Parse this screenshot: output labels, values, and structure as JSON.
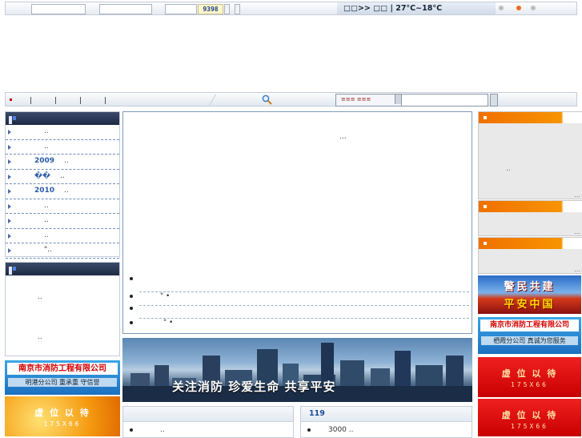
{
  "topbar": {
    "counter": "9398",
    "weather": "□□>> □□ | 27°C~18°C"
  },
  "colors": {
    "accent_orange": "#f07000",
    "accent_red": "#d40000",
    "accent_blue": "#1c4f9c",
    "nav_dark": "#1e2a44"
  },
  "nav": {
    "search_select": "≡≡≡ ≡≡≡",
    "icons": [
      "red-square-icon",
      "search-icon",
      "dropdown-arrow-icon"
    ]
  },
  "left": {
    "box1_rows": [
      {
        "year": "",
        "text": ".."
      },
      {
        "year": "",
        "text": ".."
      },
      {
        "year": "2009",
        "text": ".."
      },
      {
        "year": "��",
        "text": ".."
      },
      {
        "year": "2010",
        "text": ".."
      },
      {
        "year": "",
        "text": ".."
      },
      {
        "year": "",
        "text": ".."
      },
      {
        "year": "",
        "text": ".."
      },
      {
        "year": "",
        "text": "\".."
      }
    ],
    "box2_items": [
      "..",
      ".."
    ],
    "ad1": {
      "line1": "南京市消防工程有限公司",
      "line2": "明港分公司  重承重  守信誉"
    },
    "ad2": {
      "line1": "虚 位 以 待",
      "line2": "175X66"
    }
  },
  "center": {
    "ellipsis": "...",
    "items": [
      "",
      "\"  •",
      "",
      "\"  •"
    ],
    "banner_text": "关注消防  珍爱生命  共享平安",
    "box1": {
      "title": "",
      "items": [
        ".."
      ]
    },
    "box2": {
      "title": "119",
      "items": [
        "3000 .."
      ]
    }
  },
  "right": {
    "box1_text": "..",
    "more": "...",
    "banner_jmgj": {
      "line1": "警民共建",
      "line2": "平安中国"
    },
    "ad_company": {
      "line1": "南京市消防工程有限公司",
      "line2": "栖霞分公司  真诚为您服务"
    },
    "ad_red1": {
      "line1": "虚 位 以 待",
      "line2": "175X66"
    },
    "ad_red2": {
      "line1": "虚 位 以 待",
      "line2": "175X66"
    }
  }
}
